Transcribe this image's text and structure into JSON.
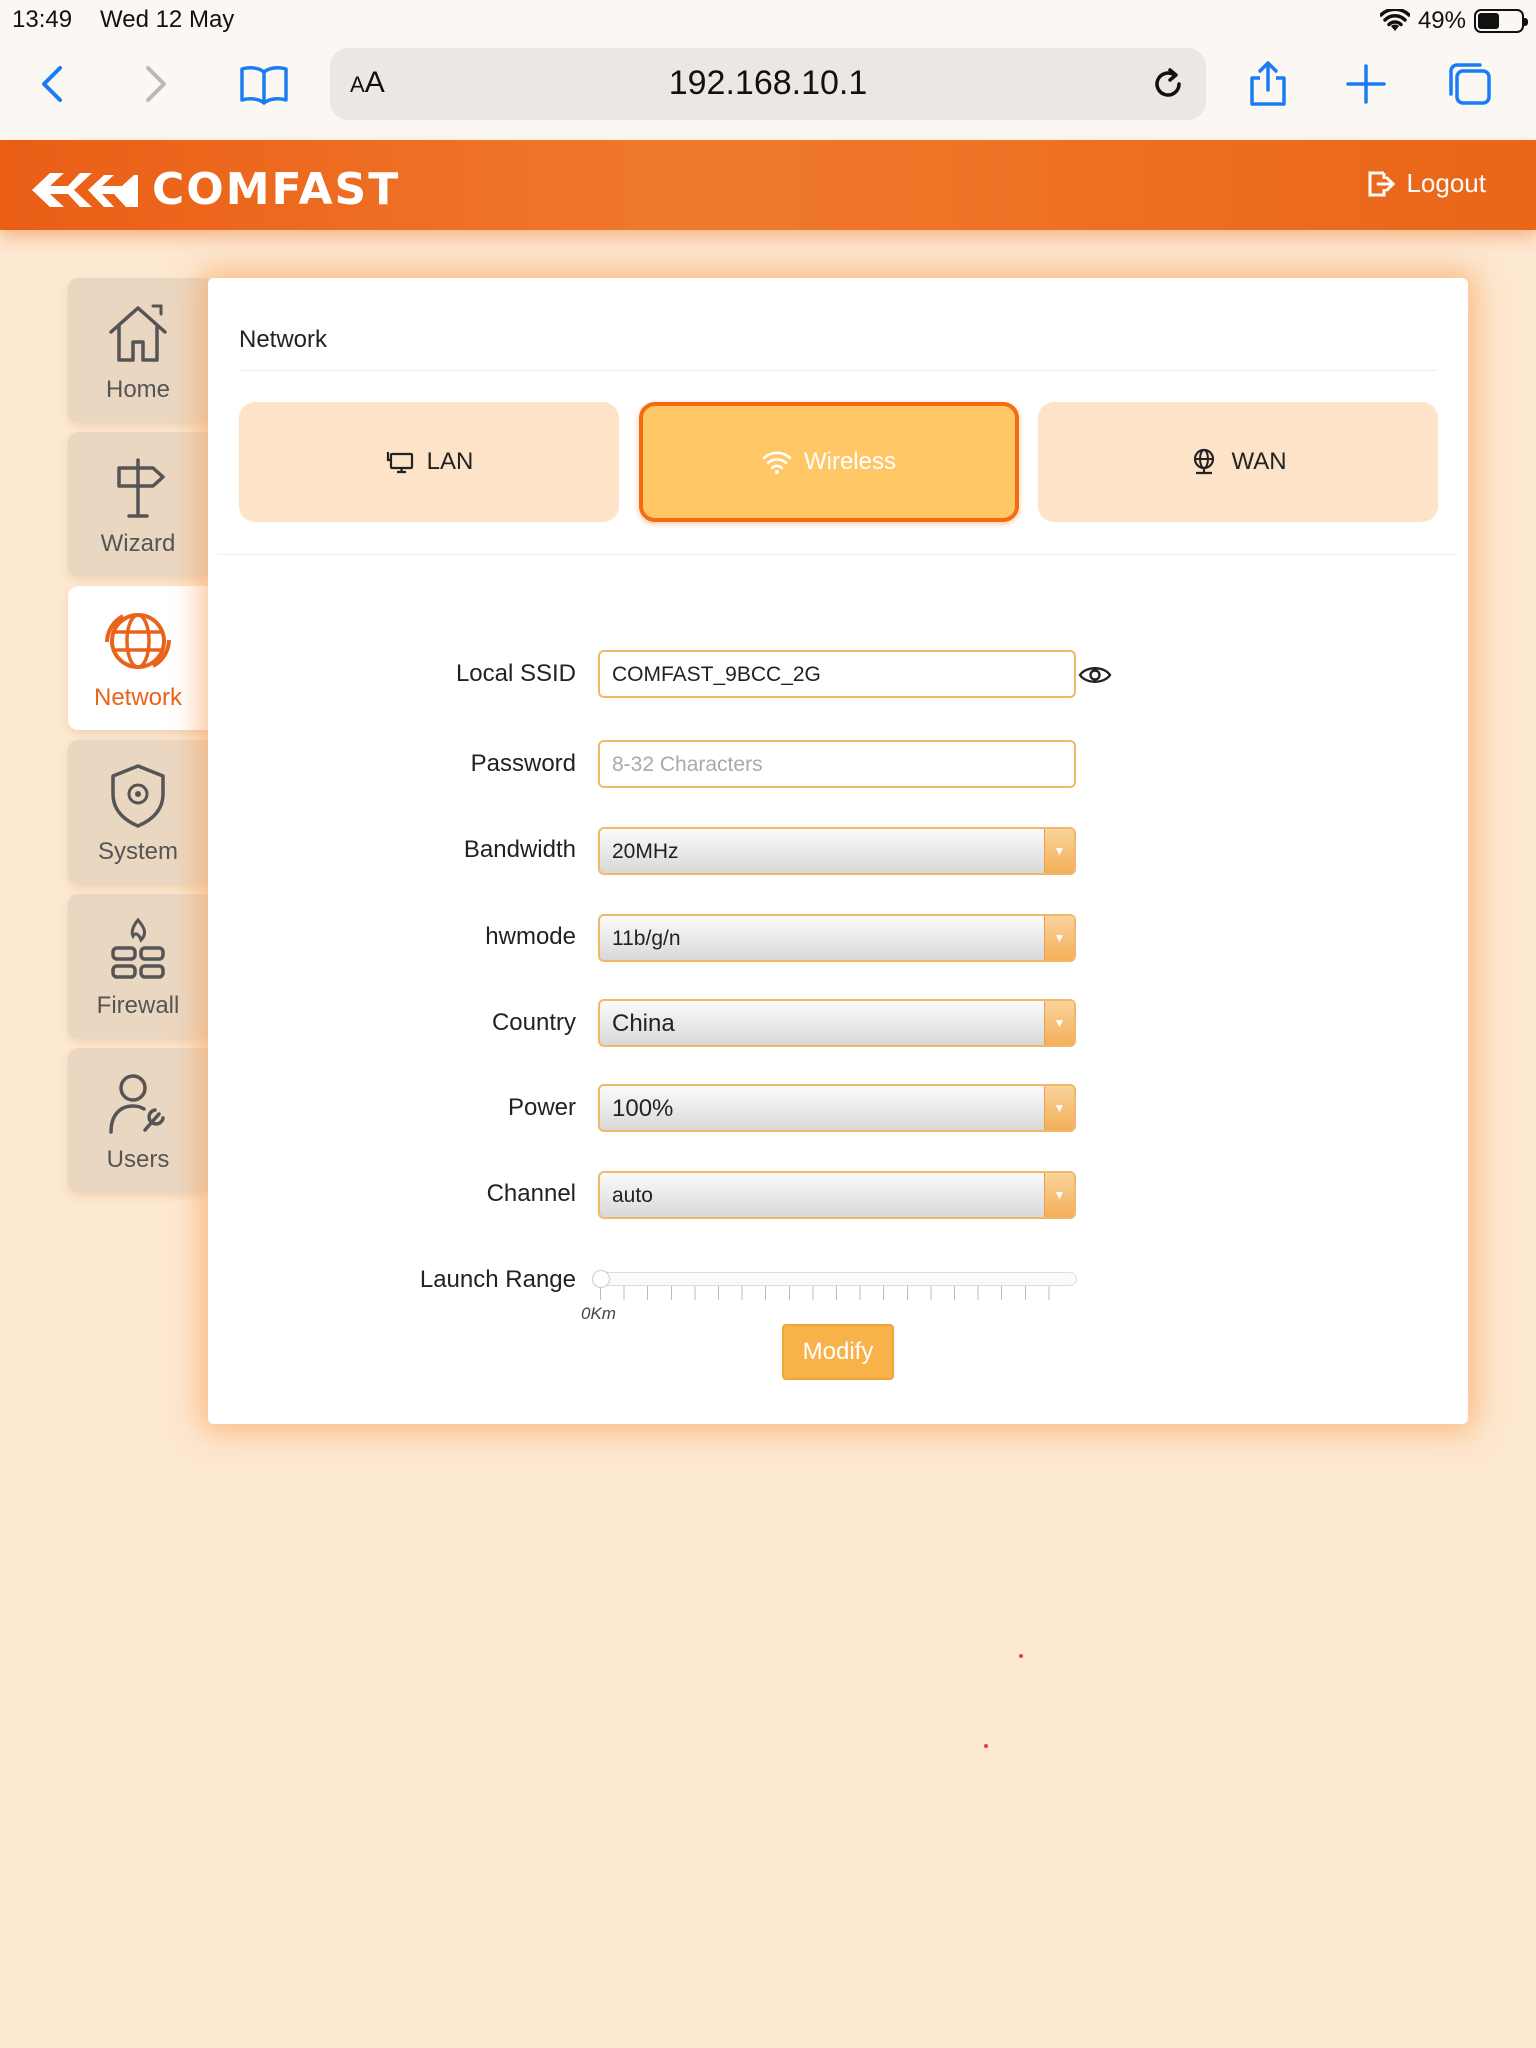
{
  "status_bar": {
    "time": "13:49",
    "date": "Wed 12 May",
    "battery_text": "49%",
    "battery_level": 0.49
  },
  "browser": {
    "aa_label_small": "A",
    "aa_label_large": "A",
    "url": "192.168.10.1",
    "accent_color": "#1a7cf5"
  },
  "header": {
    "brand": "COMFAST",
    "logout_label": "Logout",
    "color": "#ea5e16"
  },
  "sidebar": {
    "items": [
      {
        "label": "Home",
        "icon": "home-icon",
        "active": false
      },
      {
        "label": "Wizard",
        "icon": "signpost-icon",
        "active": false
      },
      {
        "label": "Network",
        "icon": "globe-sync-icon",
        "active": true
      },
      {
        "label": "System",
        "icon": "shield-gear-icon",
        "active": false
      },
      {
        "label": "Firewall",
        "icon": "firewall-icon",
        "active": false
      },
      {
        "label": "Users",
        "icon": "user-wrench-icon",
        "active": false
      }
    ]
  },
  "panel": {
    "title": "Network",
    "tabs": [
      {
        "label": "LAN",
        "icon": "lan-icon",
        "active": false
      },
      {
        "label": "Wireless",
        "icon": "wifi-icon",
        "active": true
      },
      {
        "label": "WAN",
        "icon": "globe-icon",
        "active": false
      }
    ]
  },
  "form": {
    "ssid": {
      "label": "Local SSID",
      "value": "COMFAST_9BCC_2G"
    },
    "password": {
      "label": "Password",
      "value": "",
      "placeholder": "8-32 Characters"
    },
    "bandwidth": {
      "label": "Bandwidth",
      "value": "20MHz"
    },
    "hwmode": {
      "label": "hwmode",
      "value": "11b/g/n"
    },
    "country": {
      "label": "Country",
      "value": "China"
    },
    "power": {
      "label": "Power",
      "value": "100%"
    },
    "channel": {
      "label": "Channel",
      "value": "auto"
    },
    "launch_range": {
      "label": "Launch Range",
      "min_label": "0Km",
      "value_km": 0
    },
    "submit_label": "Modify"
  }
}
